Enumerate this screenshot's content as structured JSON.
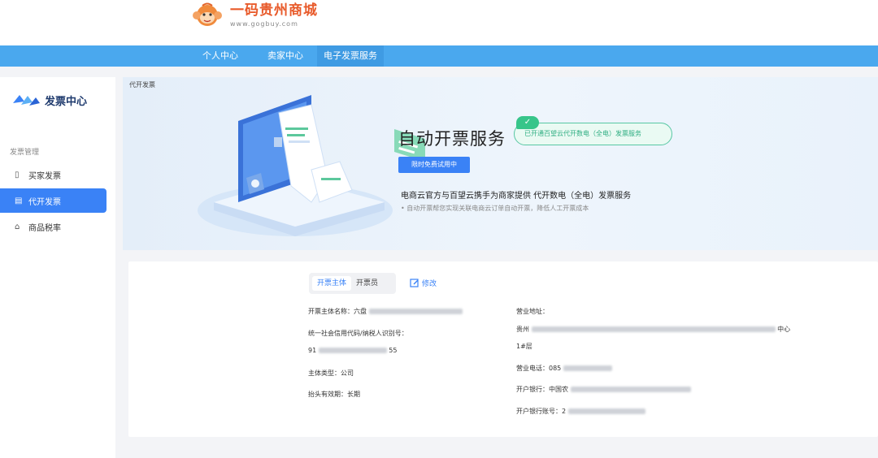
{
  "header": {
    "logo_cn": "一码贵州商城",
    "logo_url": "www.gogbuy.com"
  },
  "nav": {
    "items": [
      {
        "label": "个人中心"
      },
      {
        "label": "卖家中心"
      },
      {
        "label": "电子发票服务"
      }
    ]
  },
  "sidebar": {
    "title": "发票中心",
    "group_label": "发票管理",
    "items": [
      {
        "label": "买家发票",
        "icon": "document-icon"
      },
      {
        "label": "代开发票",
        "icon": "invoice-icon"
      },
      {
        "label": "商品税率",
        "icon": "tax-icon"
      }
    ]
  },
  "banner": {
    "breadcrumb": "代开发票",
    "title": "自动开票服务",
    "badge": "已开通百望云代开数电（全电）发票服务",
    "button": "限时免费试用中",
    "description": "电商云官方与百望云携手为商家提供 代开数电（全电）发票服务",
    "subtext": "• 自动开票帮您实现关联电商云订单自动开票，降低人工开票成本"
  },
  "details": {
    "tabs": [
      "开票主体",
      "开票员"
    ],
    "edit_label": "修改",
    "left": [
      {
        "label": "开票主体名称：",
        "value": "六盘"
      },
      {
        "label": "统一社会信用代码/纳税人识别号：",
        "value": ""
      },
      {
        "label": "",
        "value_start": "91",
        "value_end": "55"
      },
      {
        "label": "主体类型：",
        "value": "公司"
      },
      {
        "label": "抬头有效期：",
        "value": "长期"
      }
    ],
    "right": [
      {
        "label": "营业地址：",
        "value": ""
      },
      {
        "label": "",
        "value_start": "贵州",
        "value_end": "中心"
      },
      {
        "label": "",
        "value_end": "1#层"
      },
      {
        "label": "营业电话：",
        "value": "085"
      },
      {
        "label": "开户银行：",
        "value": "中国农"
      },
      {
        "label": "开户银行账号：",
        "value": "2"
      }
    ]
  },
  "colors": {
    "primary": "#3a82f6",
    "nav": "#4aa8ee",
    "success": "#37c58a",
    "logo": "#e85a2a"
  }
}
